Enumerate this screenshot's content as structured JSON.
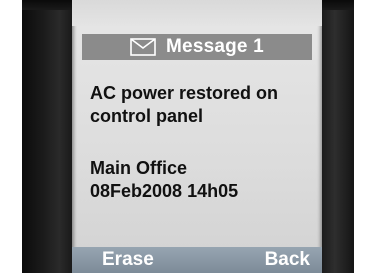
{
  "header": {
    "title": "Message 1",
    "icon": "envelope-icon"
  },
  "message": {
    "lines": [
      "AC power restored on",
      "control panel",
      "Main Office",
      "08Feb2008 14h05"
    ]
  },
  "softkeys": {
    "left_label": "Erase",
    "right_label": "Back"
  },
  "colors": {
    "title_bar": "#8b8b8b",
    "softkey_bar": "#8795a2",
    "screen_bg": "#dedede",
    "text": "#111111"
  }
}
